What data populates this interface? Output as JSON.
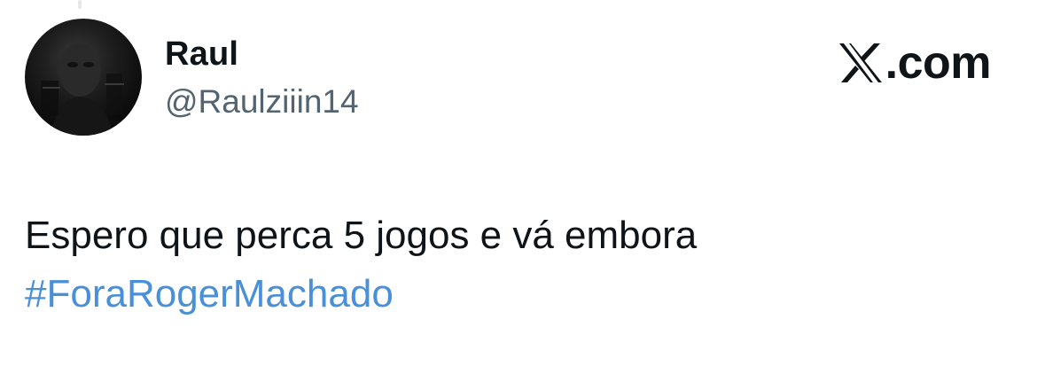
{
  "tweet": {
    "author": {
      "name": "Raul",
      "handle": "@Raulziiin14",
      "avatar_icon": "profile-photo"
    },
    "text": "Espero que perca 5 jogos e vá embora",
    "hashtag": "#ForaRogerMachado"
  },
  "brand": {
    "logo_icon": "x-logo-icon",
    "domain_suffix": ".com"
  },
  "colors": {
    "text": "#0f1419",
    "handle": "#536471",
    "hashtag": "#4a90d9",
    "background": "#ffffff"
  }
}
